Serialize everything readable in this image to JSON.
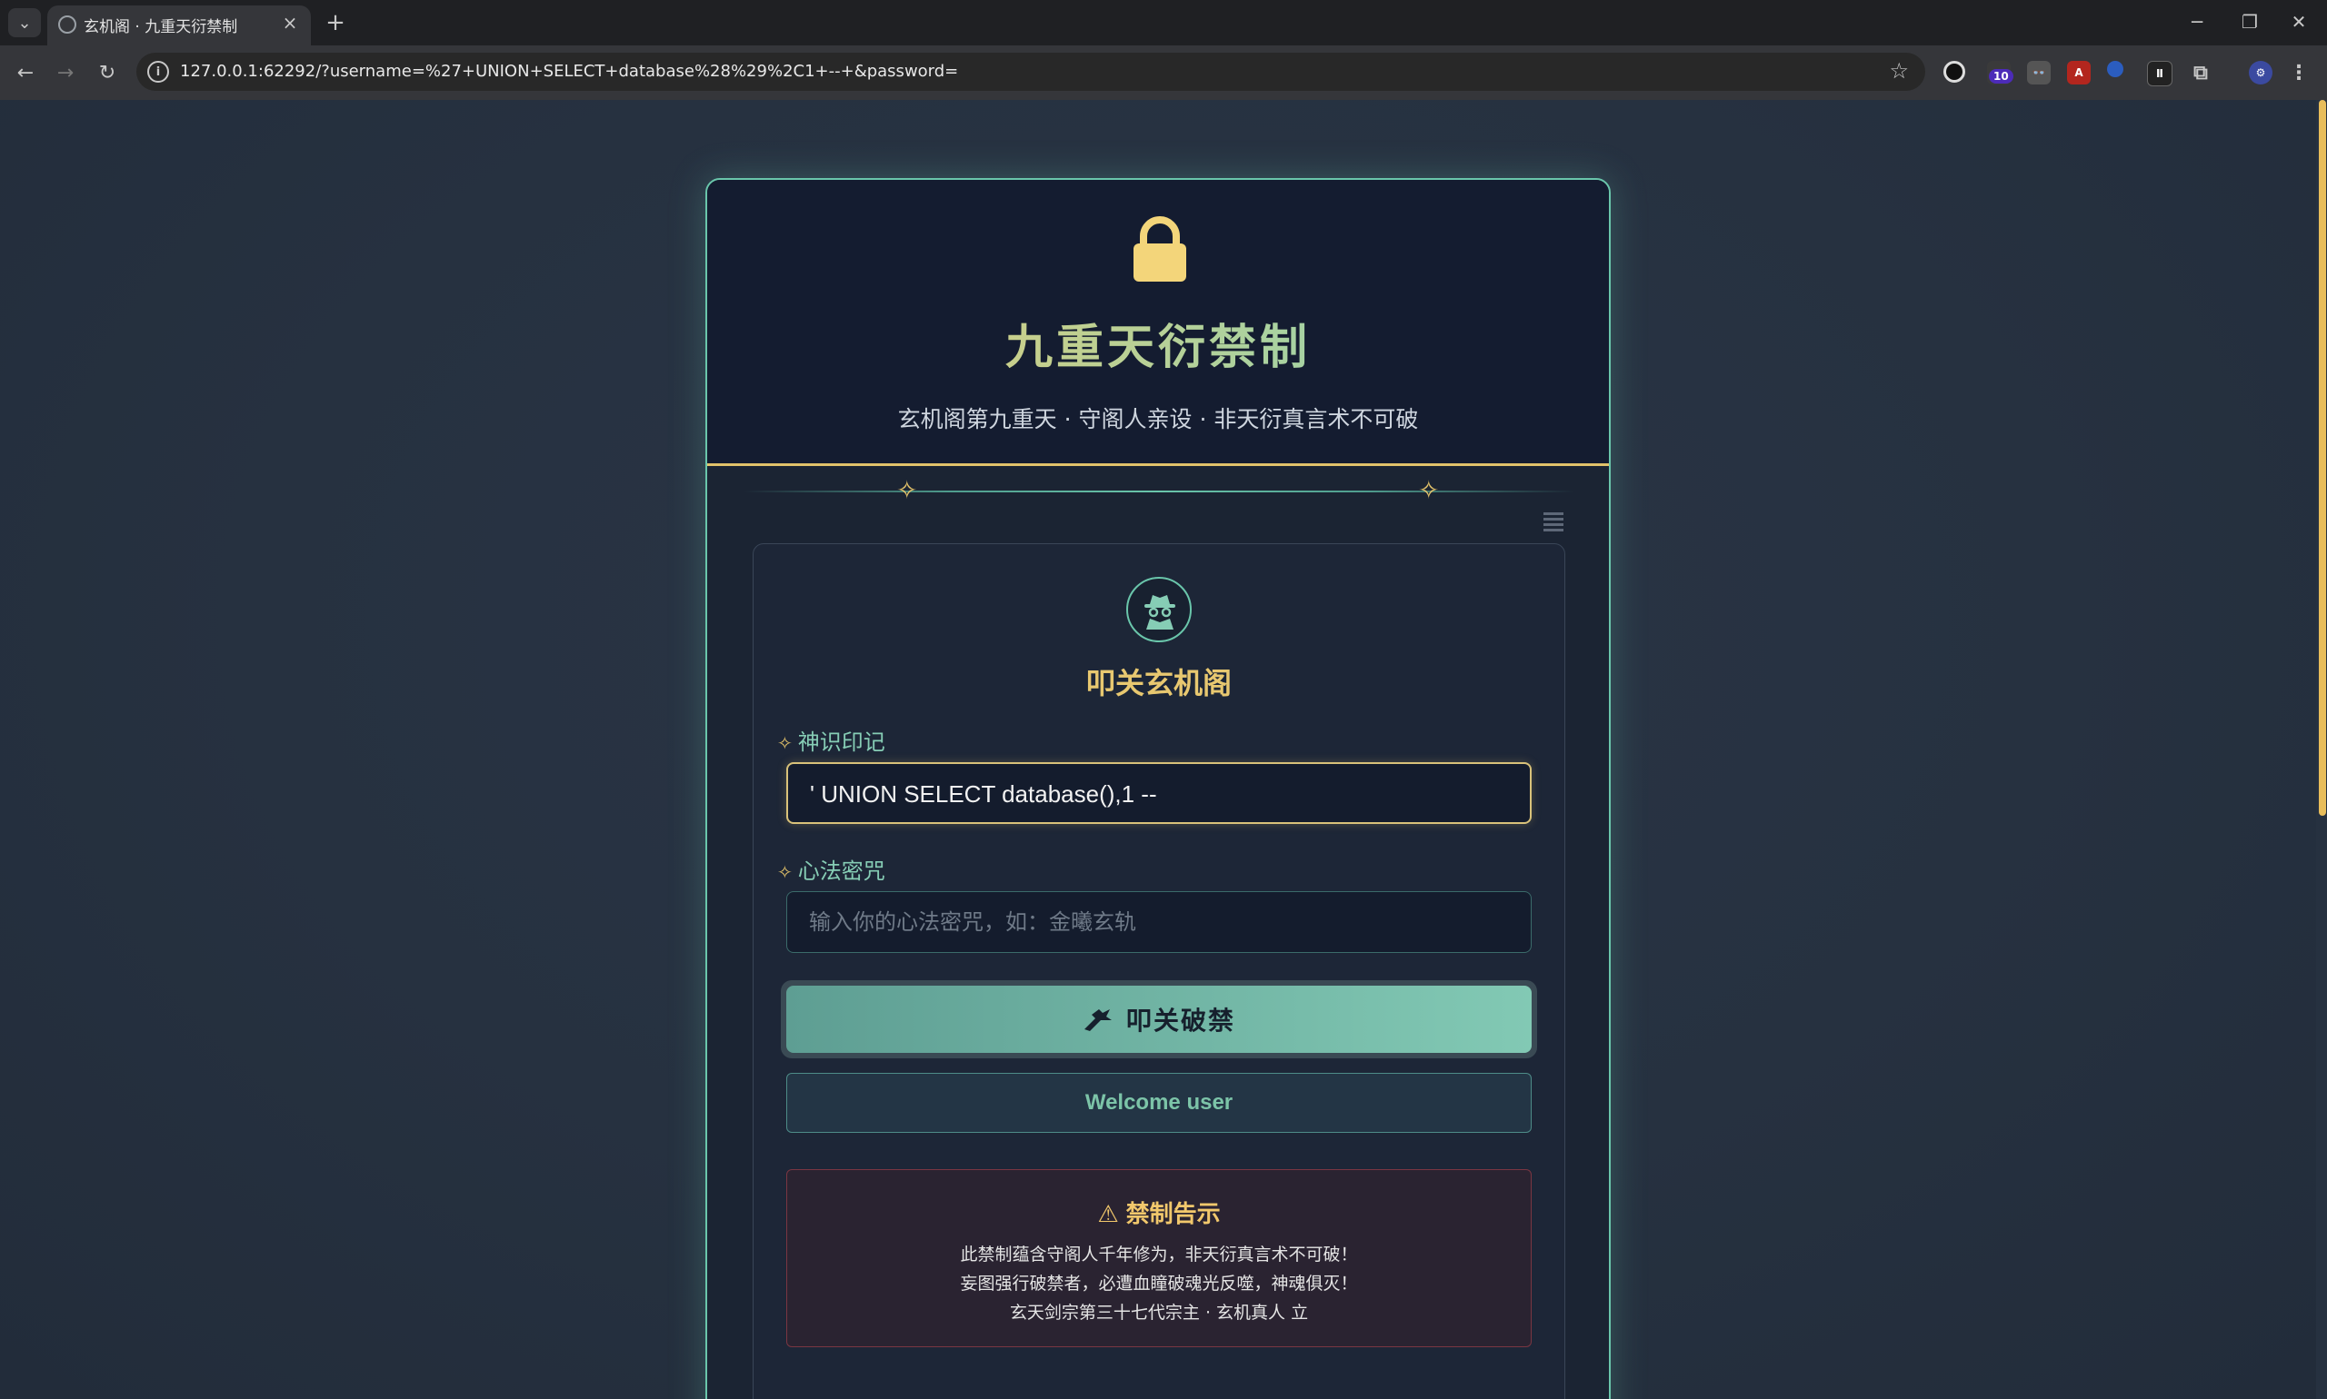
{
  "browser": {
    "tab_title": "玄机阁 · 九重天衍禁制",
    "url": "127.0.0.1:62292/?username=%27+UNION+SELECT+database%28%29%2C1+--+&password=",
    "extension_badge": "10"
  },
  "header": {
    "title": "九重天衍禁制",
    "subtitle": "玄机阁第九重天 · 守阁人亲设 · 非天衍真言术不可破"
  },
  "form": {
    "title": "叩关玄机阁",
    "username_label": "神识印记",
    "username_value": "' UNION SELECT database(),1 --",
    "password_label": "心法密咒",
    "password_placeholder": "输入你的心法密咒，如：金曦玄轨",
    "submit_label": "叩关破禁",
    "result_text": "Welcome user"
  },
  "warning": {
    "title": "禁制告示",
    "line1": "此禁制蕴含守阁人千年修为，非天衍真言术不可破！",
    "line2": "妄图强行破禁者，必遭血瞳破魂光反噬，神魂俱灭！",
    "line3": "玄天剑宗第三十七代宗主 · 玄机真人 立"
  },
  "colors": {
    "accent_teal": "#6ac6ab",
    "accent_gold": "#e2c26a",
    "card_bg": "#1b2433",
    "page_bg": "#263140"
  },
  "icons": [
    "lock-icon",
    "spy-icon",
    "swords-icon",
    "warning-icon",
    "sparkle-icon",
    "menu-icon"
  ]
}
